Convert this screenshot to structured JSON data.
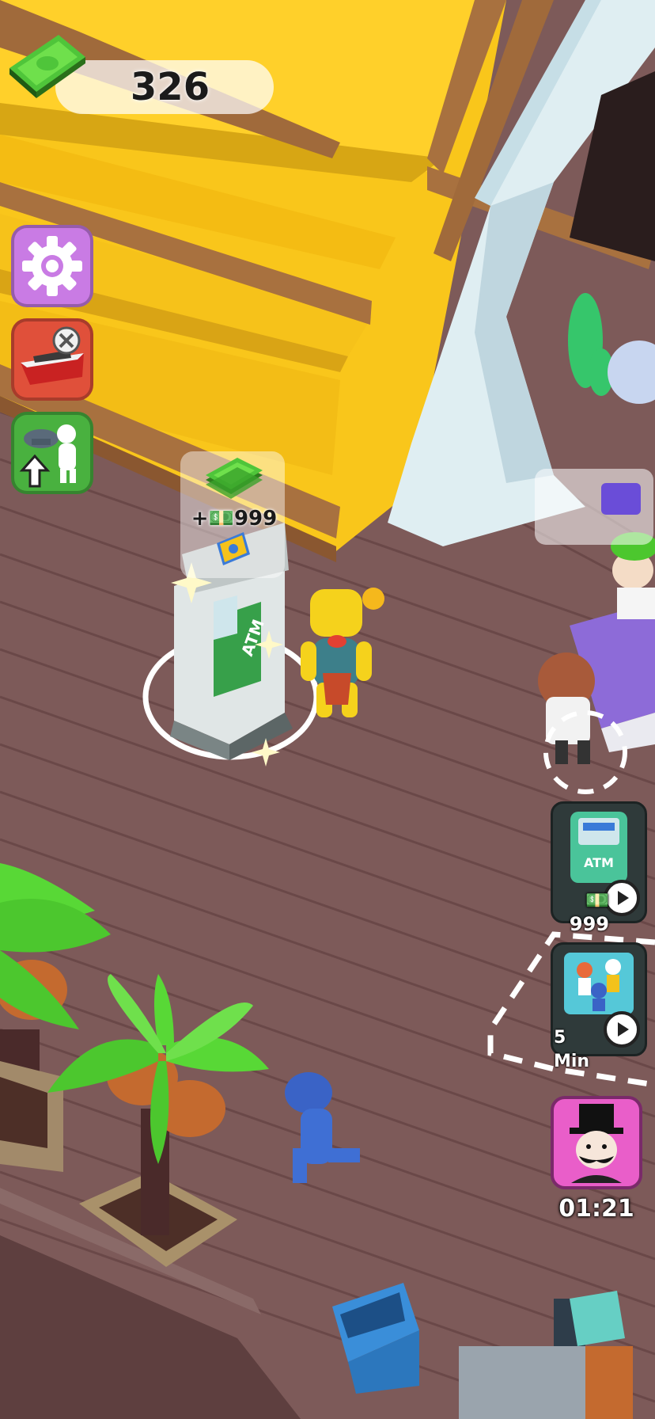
{
  "hud": {
    "cash_amount": "326",
    "cash_icon": "cash-stack-icon"
  },
  "side_menu": {
    "items": [
      {
        "name": "settings",
        "icon": "gear-icon",
        "color": "#c97be4"
      },
      {
        "name": "boat-shop",
        "icon": "boat-utensils-icon",
        "color": "#e0503a"
      },
      {
        "name": "staff-upgrade",
        "icon": "staff-upgrade-arrow-icon",
        "color": "#49b13f"
      }
    ]
  },
  "atm_station": {
    "reward_label": "+💵999",
    "reward_icon": "cash-stack-icon",
    "ticket_icon": "atm-ticket-icon"
  },
  "right_panel": {
    "atm_offer": {
      "label": "💵999",
      "icon": "atm-machine-icon",
      "action_icon": "play-icon"
    },
    "speed_offer": {
      "label": "5 Min",
      "icon": "running-customers-icon",
      "action_icon": "play-icon"
    },
    "visitor": {
      "timer": "01:21",
      "icon": "top-hat-gentleman-icon",
      "color": "#e95ec9"
    }
  },
  "colors": {
    "deck": "#7d5a59",
    "roof": "#f9c61b",
    "palm_leaf": "#58d836",
    "player": "#f5d21c"
  }
}
